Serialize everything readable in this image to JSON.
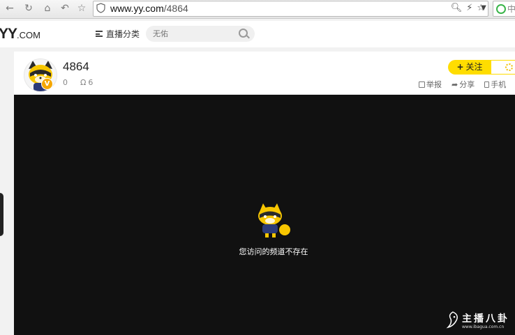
{
  "browser": {
    "url_domain": "www.yy.com",
    "url_path": "/4864",
    "ext_label": "中"
  },
  "site": {
    "logo_main": "YY",
    "logo_suffix": ".COM",
    "category_label": "直播分类",
    "search_placeholder": "无佑"
  },
  "channel": {
    "title": "4864",
    "fans_count": "0",
    "viewer_count": "6",
    "follow_label": "关注",
    "badge_label": "V",
    "actions": [
      {
        "label": "举报"
      },
      {
        "label": "分享"
      },
      {
        "label": "手机"
      }
    ]
  },
  "player": {
    "message": "您访问的频道不存在"
  },
  "watermark": {
    "text": "主播八卦",
    "url": "www.ibagua.com.cn"
  },
  "colors": {
    "accent": "#ffdd00",
    "player_bg": "#111111"
  }
}
